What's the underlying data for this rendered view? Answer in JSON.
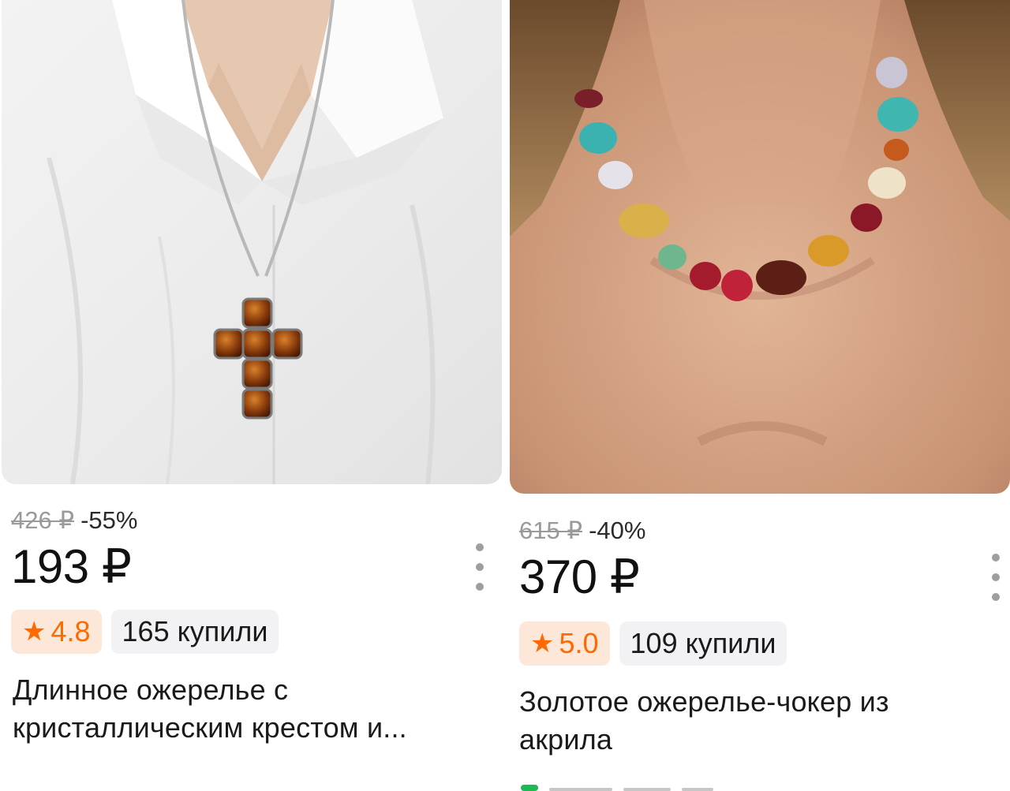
{
  "products": [
    {
      "old_price": "426 ₽",
      "discount": "-55%",
      "price": "193 ₽",
      "rating": "4.8",
      "bought": "165 купили",
      "title_line1": "Длинное ожерелье с",
      "title_line2": "кристаллическим крестом и..."
    },
    {
      "old_price": "615 ₽",
      "discount": "-40%",
      "price": "370 ₽",
      "rating": "5.0",
      "bought": "109 купили",
      "title_line1": "Золотое ожерелье-чокер из",
      "title_line2": "акрила"
    }
  ],
  "colors": {
    "rating_orange": "#ff6a00",
    "rating_bg": "#fde7d9",
    "bought_bg": "#f2f2f5",
    "old_price_gray": "#9a9a9a"
  },
  "icons": {
    "star": "★",
    "more": "more-vertical-icon"
  }
}
